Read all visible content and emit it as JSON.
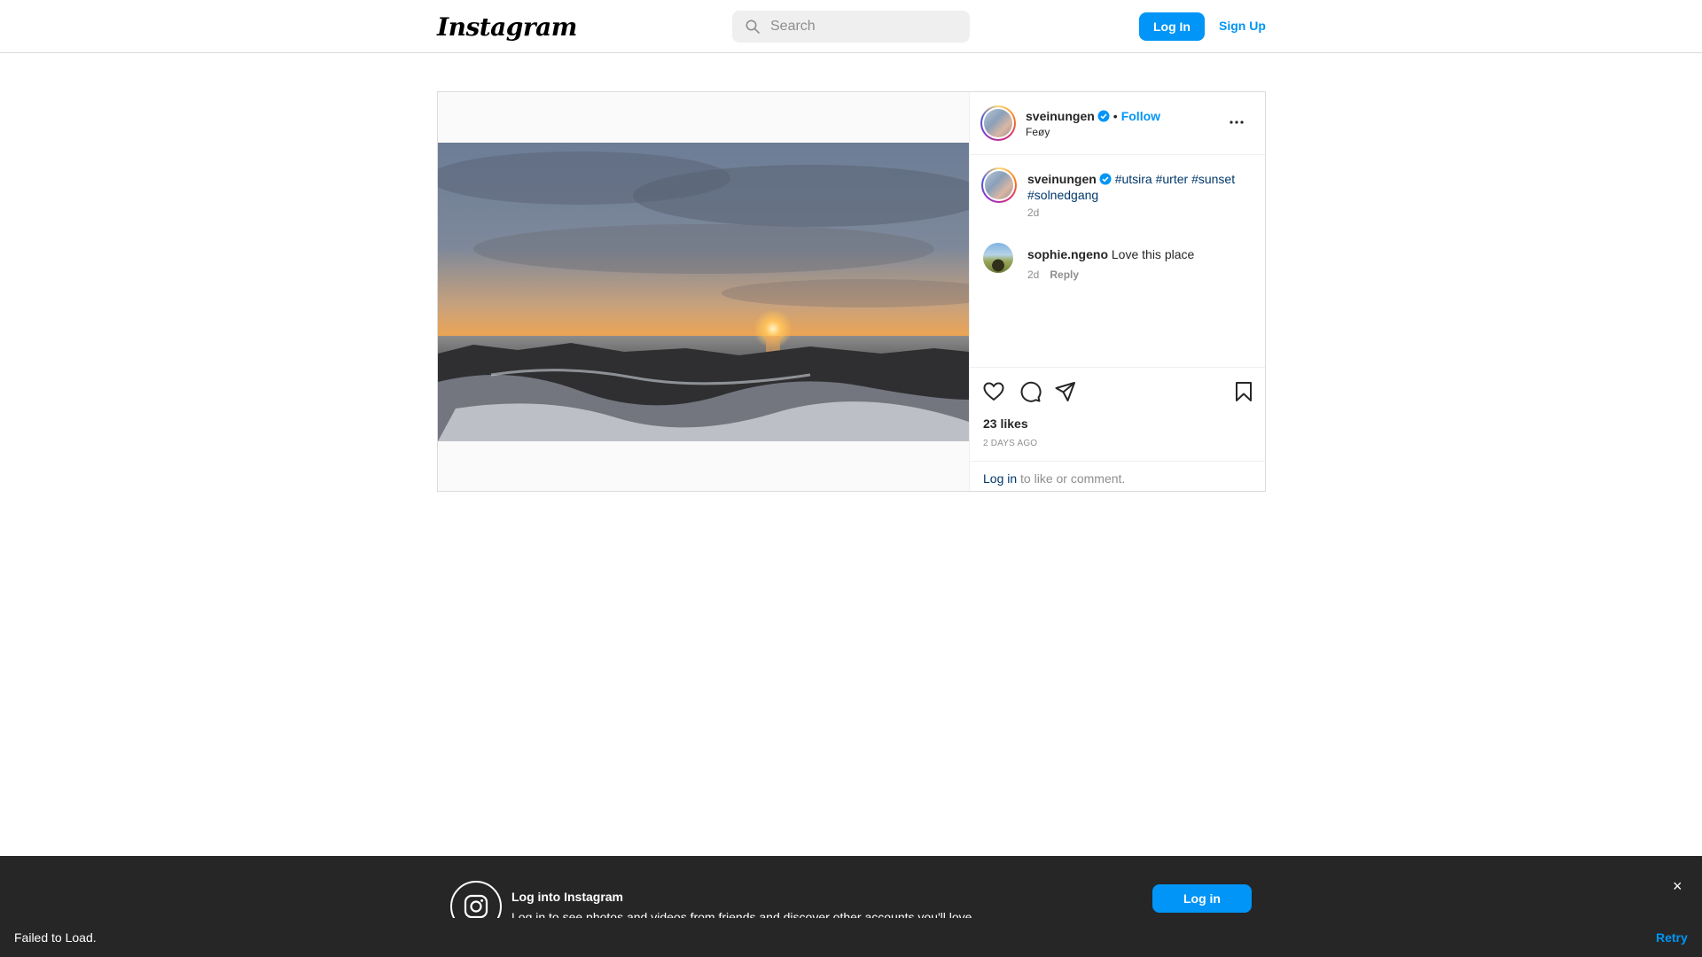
{
  "header": {
    "logo_text": "Instagram",
    "search_placeholder": "Search",
    "login_label": "Log In",
    "signup_label": "Sign Up"
  },
  "post": {
    "author": "sveinungen",
    "follow_label": "Follow",
    "separator": "•",
    "location": "Feøy",
    "caption": {
      "username": "sveinungen",
      "hashtags": [
        "#utsira",
        "#urter",
        "#sunset",
        "#solnedgang"
      ],
      "time": "2d"
    },
    "comments": [
      {
        "username": "sophie.ngeno",
        "text": "Love this place",
        "time": "2d",
        "reply_label": "Reply"
      }
    ],
    "likes": "23 likes",
    "posted": "2 DAYS AGO",
    "login_prompt": {
      "link": "Log in",
      "rest": " to like or comment."
    }
  },
  "banner": {
    "title": "Log into Instagram",
    "subtitle": "Log in to see photos and videos from friends and discover other accounts you'll love.",
    "login_label": "Log in",
    "close_glyph": "×"
  },
  "toast": {
    "message": "Failed to Load.",
    "retry_label": "Retry"
  },
  "colors": {
    "accent": "#0095f6",
    "link_dark": "#00376b",
    "muted": "#8e8e8e",
    "banner_bg": "#262626"
  }
}
